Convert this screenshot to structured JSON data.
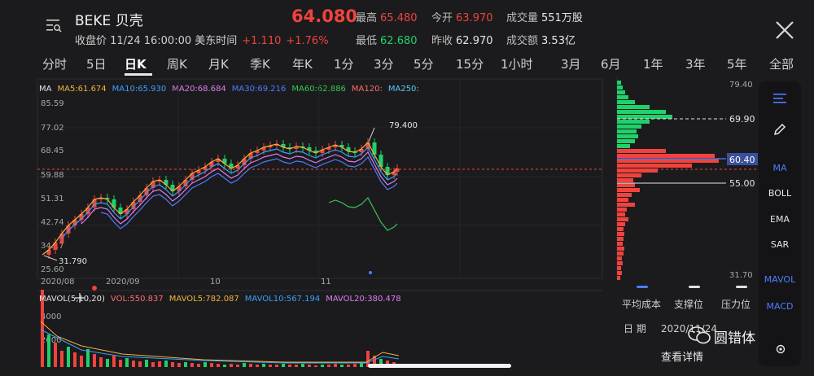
{
  "header": {
    "ticker": "BEKE 贝壳",
    "status": "收盘价 11/24 16:00:00 美东时间",
    "change": "+1.110",
    "change_pct": "+1.76%",
    "price": "64.080",
    "stats": [
      {
        "label": "最高",
        "value": "65.480",
        "tone": "red"
      },
      {
        "label": "今开",
        "value": "63.970",
        "tone": "red"
      },
      {
        "label": "成交量",
        "value": "551万股",
        "tone": "plain"
      },
      {
        "label": "最低",
        "value": "62.680",
        "tone": "green"
      },
      {
        "label": "昨收",
        "value": "62.970",
        "tone": "plain"
      },
      {
        "label": "成交额",
        "value": "3.53亿",
        "tone": "plain"
      }
    ]
  },
  "tabs": [
    "分时",
    "5日",
    "日K",
    "周K",
    "月K",
    "季K",
    "年K",
    "1分",
    "3分",
    "5分",
    "15分",
    "1小时",
    "3月",
    "6月",
    "1年",
    "3年",
    "5年",
    "全部"
  ],
  "active_tab": "日K",
  "ma_bar": {
    "label": "MA",
    "items": [
      {
        "text": "MA5:61.674",
        "color": "#f2b33d"
      },
      {
        "text": "MA10:65.930",
        "color": "#3aa0ff"
      },
      {
        "text": "MA20:68.684",
        "color": "#e07cf0"
      },
      {
        "text": "MA30:69.216",
        "color": "#4f7cff"
      },
      {
        "text": "MA60:62.886",
        "color": "#34c759"
      },
      {
        "text": "MA120:",
        "color": "#ff6b6b"
      },
      {
        "text": "MA250:",
        "color": "#5ac8fa"
      }
    ]
  },
  "axis": {
    "left_y_ticks": [
      "85.59",
      "77.02",
      "68.45",
      "59.88",
      "51.31",
      "42.74",
      "34.17",
      "25.60"
    ],
    "x_ticks": [
      "2020/08",
      "2020/09",
      "10",
      "11"
    ],
    "annotation_high": "79.400",
    "annotation_low": "31.790",
    "right_top": "79.40",
    "right_bottom": "31.70",
    "level_pressure": "69.90",
    "level_avg": "60.40",
    "level_support": "55.00",
    "volume_ticks": [
      "4000",
      "2000"
    ]
  },
  "mavol_bar": {
    "label": "MAVOL(5,10,20)",
    "items": [
      {
        "text": "VOL:550.837",
        "color": "#ff6b6b"
      },
      {
        "text": "MAVOL5:782.087",
        "color": "#f2b33d"
      },
      {
        "text": "MAVOL10:567.194",
        "color": "#3aa0ff"
      },
      {
        "text": "MAVOL20:380.478",
        "color": "#e07cf0"
      }
    ]
  },
  "profile_legend": {
    "items": [
      {
        "label": "平均成本",
        "color": "#4f7cff"
      },
      {
        "label": "支撑位",
        "color": "#e0e0e0"
      },
      {
        "label": "压力位",
        "color": "#e0e0e0"
      }
    ]
  },
  "date_row": {
    "label": "日   期",
    "value": "2020/11/24"
  },
  "detail_link": "查看详情",
  "side_panel": {
    "items": [
      {
        "text": "MA",
        "tone": "blue"
      },
      {
        "text": "BOLL",
        "tone": "plain"
      },
      {
        "text": "EMA",
        "tone": "plain"
      },
      {
        "text": "SAR",
        "tone": "plain"
      },
      {
        "text": "MAVOL",
        "tone": "blue"
      },
      {
        "text": "MACD",
        "tone": "blue"
      }
    ]
  },
  "watermark": "圆错体",
  "colors": {
    "up": "#f0433d",
    "down": "#1fd16a",
    "accent": "#4f7cff"
  }
}
